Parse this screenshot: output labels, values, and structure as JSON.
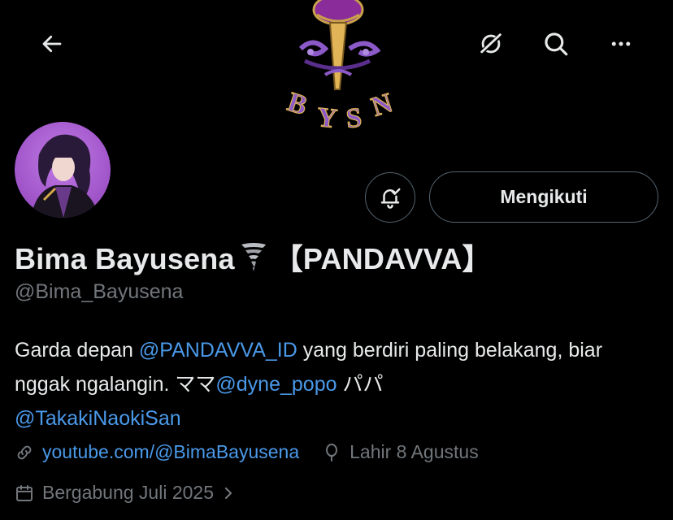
{
  "banner": {
    "logo_text": "BYSN"
  },
  "profile": {
    "display_name": "Bima Bayusena",
    "name_emoji": "tornado-icon",
    "name_suffix": "【PANDAVVA】",
    "handle": "@Bima_Bayusena",
    "follow_label": "Mengikuti"
  },
  "bio": {
    "part1": "Garda depan ",
    "mention1": "@PANDAVVA_ID",
    "part2": " yang berdiri paling belakang, biar nggak ngalangin. ママ",
    "mention2": "@dyne_popo",
    "part3": " パパ ",
    "mention3": "@TakakiNaokiSan"
  },
  "meta": {
    "website": "youtube.com/@BimaBayusena",
    "birthday": "Lahir 8 Agustus",
    "joined": "Bergabung Juli 2025"
  },
  "colors": {
    "background": "#000000",
    "text": "#e7e9ea",
    "muted": "#71767b",
    "link": "#4a99e9",
    "border": "#536471"
  }
}
